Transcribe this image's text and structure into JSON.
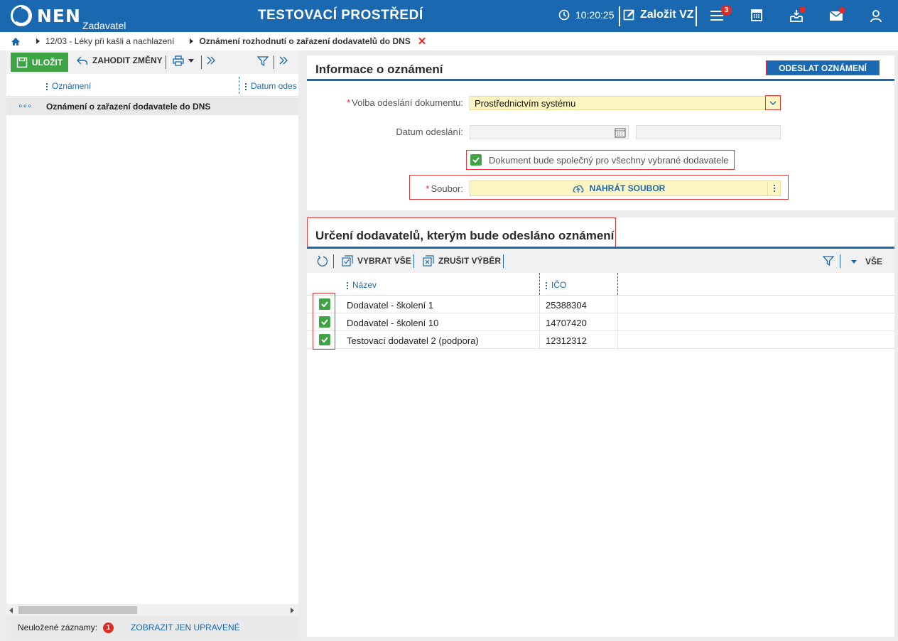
{
  "app": {
    "logo_text": "NEN",
    "logo_sub": "Zadavatel",
    "env_title": "TESTOVACÍ PROSTŘEDÍ",
    "clock": "10:20:25",
    "new_button": "Založit VZ",
    "menu_badge": "3",
    "colors": {
      "brand": "#1a69b0",
      "save": "#3fa446",
      "alert": "#e02b27",
      "highlight_field": "#fdf6c3"
    },
    "icons": [
      "clock-icon",
      "edit-icon",
      "menu-icon",
      "calculator-icon",
      "inbox-icon",
      "mail-icon",
      "user-icon"
    ]
  },
  "breadcrumb": {
    "parent": "12/03 - Léky při kašli a nachlazení",
    "current": "Oznámení rozhodnutí o zařazení dodavatelů do DNS"
  },
  "left": {
    "toolbar": {
      "save": "ULOŽIT",
      "discard": "ZAHODIT ZMĚNY"
    },
    "columns": {
      "col1": "Oznámení",
      "col2": "Datum odes"
    },
    "row": {
      "dots": "∘∘∘",
      "title": "Oznámení o zařazení dodavatele do DNS"
    },
    "footer": {
      "unsaved_label": "Neuložené záznamy:",
      "unsaved_count": "1",
      "show_modified": "ZOBRAZIT JEN UPRAVENÉ"
    }
  },
  "info": {
    "title": "Informace o oznámení",
    "send_button": "ODESLAT OZNÁMENÍ",
    "fields": {
      "send_mode_label": "Volba odeslání dokumentu:",
      "send_mode_value": "Prostřednictvím systému",
      "send_date_label": "Datum odeslání:",
      "common_doc_label": "Dokument bude společný pro všechny vybrané dodavatele",
      "file_label": "Soubor:",
      "upload_button": "NAHRÁT SOUBOR"
    }
  },
  "suppliers": {
    "title": "Určení dodavatelů, kterým bude odesláno oznámení",
    "toolbar": {
      "select_all": "VYBRAT VŠE",
      "clear_selection": "ZRUŠIT VÝBĚR",
      "filter_scope": "VŠE"
    },
    "columns": {
      "name": "Název",
      "ico": "IČO"
    },
    "rows": [
      {
        "name": "Dodavatel - školení 1",
        "ico": "25388304",
        "checked": true
      },
      {
        "name": "Dodavatel - školení 10",
        "ico": "14707420",
        "checked": true
      },
      {
        "name": "Testovací dodavatel 2 (podpora)",
        "ico": "12312312",
        "checked": true
      }
    ]
  }
}
